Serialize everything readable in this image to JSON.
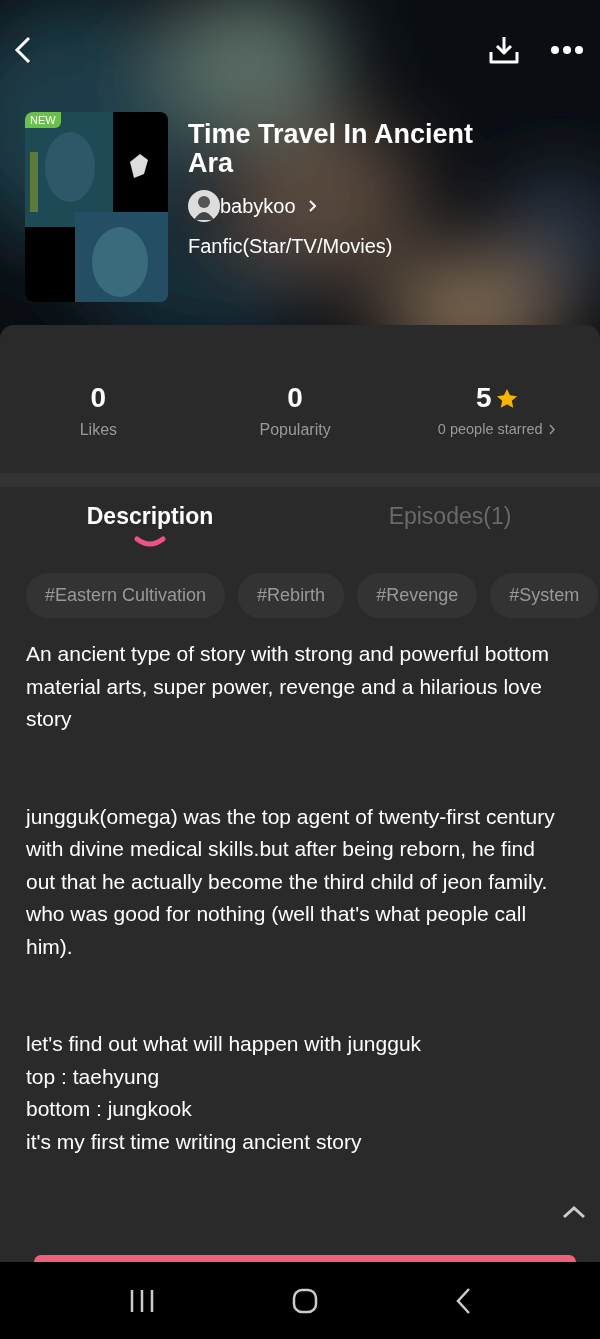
{
  "book": {
    "badge": "NEW",
    "title": "Time Travel In Ancient Ara",
    "author": "babykoo",
    "genre": "Fanfic(Star/TV/Movies)"
  },
  "stats": [
    {
      "kind": "count",
      "value": "0",
      "label": "Likes"
    },
    {
      "kind": "count",
      "value": "0",
      "label": "Popularity"
    },
    {
      "kind": "rating",
      "value": "5",
      "label": "0 people starred"
    }
  ],
  "tabs": [
    {
      "label": "Description",
      "selected": true
    },
    {
      "label": "Episodes(1)",
      "selected": false
    }
  ],
  "tags": [
    "#Eastern Cultivation",
    "#Rebirth",
    "#Revenge",
    "#System"
  ],
  "description": [
    [
      "An ancient type of story with strong and powerful bottom",
      "material arts, super power, revenge and a hilarious love story"
    ],
    [
      "jungguk(omega) was the top agent of twenty-first century with divine medical skills.but after being reborn, he find out that he actually become the third child of jeon family. who was good for nothing (well that's what people call him)."
    ],
    [
      "let's find out what will happen with jungguk",
      "top : taehyung",
      "bottom : jungkook",
      "it's my first time writing ancient story"
    ]
  ]
}
